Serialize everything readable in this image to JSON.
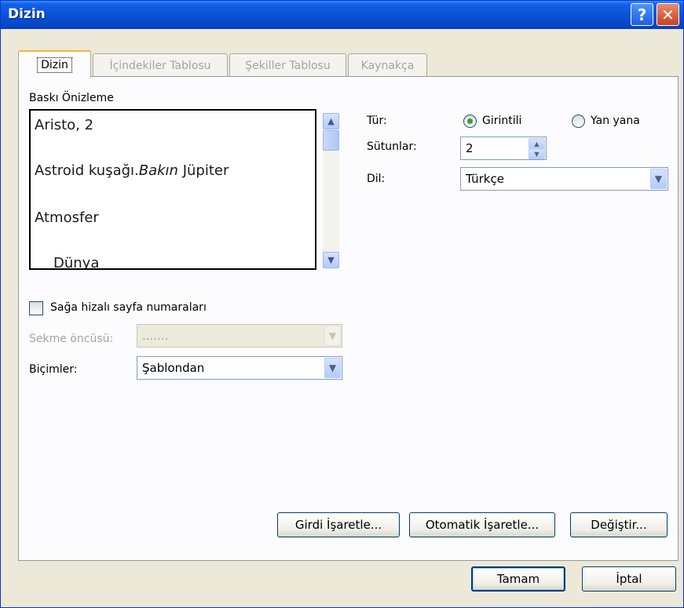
{
  "window": {
    "title": "Dizin",
    "help_glyph": "?",
    "close_glyph": "✕"
  },
  "tabs": [
    {
      "label": "Dizin",
      "active": true
    },
    {
      "label": "İçindekiler Tablosu",
      "active": false
    },
    {
      "label": "Şekiller Tablosu",
      "active": false
    },
    {
      "label": "Kaynakça",
      "active": false
    }
  ],
  "preview": {
    "label": "Baskı Önizleme",
    "lines": [
      {
        "text": "Aristo, 2"
      },
      {
        "text_before": "Astroid kuşağı.",
        "text_italic": "Bakın",
        "text_after": " Jüpiter"
      },
      {
        "text": "Atmosfer"
      },
      {
        "text": "Dünya"
      }
    ]
  },
  "options": {
    "tur_label": "Tür:",
    "tur_options": [
      {
        "label": "Girintili",
        "selected": true
      },
      {
        "label": "Yan yana",
        "selected": false
      }
    ],
    "sutunlar_label": "Sütunlar:",
    "sutunlar_value": "2",
    "dil_label": "Dil:",
    "dil_value": "Türkçe"
  },
  "left_options": {
    "checkbox_label": "Sağa hizalı sayfa numaraları",
    "checkbox_checked": false,
    "sekme_label": "Sekme öncüsü:",
    "sekme_value": ".......",
    "bicimler_label": "Biçimler:",
    "bicimler_value": "Şablondan"
  },
  "actions": {
    "girdi": "Girdi İşaretle...",
    "otomatik": "Otomatik İşaretle...",
    "degistir": "Değiştir...",
    "ok": "Tamam",
    "cancel": "İptal"
  },
  "colors": {
    "titlebar": "#0a52d8",
    "dialog_bg": "#ece9d8",
    "panel_bg": "#fcfcfe",
    "active_tab_accent": "#f0b43d",
    "radio_selected": "#2fa62f"
  }
}
